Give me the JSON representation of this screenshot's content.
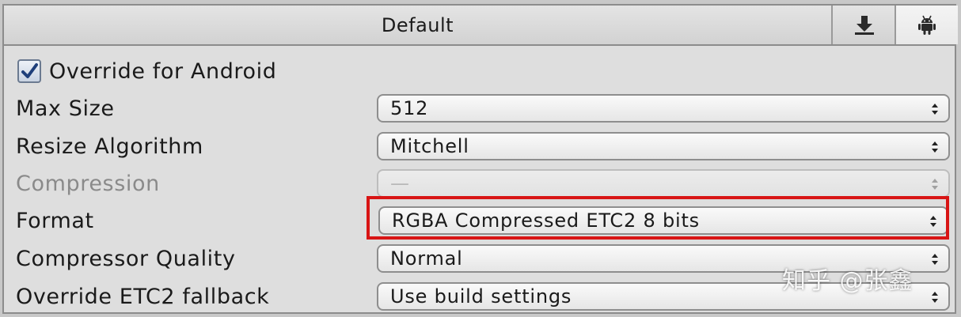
{
  "tabs": {
    "default_label": "Default",
    "download_icon": "download-icon",
    "android_icon": "android-icon"
  },
  "override": {
    "label": "Override for Android",
    "checked": true
  },
  "fields": {
    "max_size": {
      "label": "Max Size",
      "value": "512"
    },
    "resize_algorithm": {
      "label": "Resize Algorithm",
      "value": "Mitchell"
    },
    "compression": {
      "label": "Compression",
      "value": "—",
      "disabled": true
    },
    "format": {
      "label": "Format",
      "value": "RGBA Compressed ETC2 8 bits"
    },
    "compressor_quality": {
      "label": "Compressor Quality",
      "value": "Normal"
    },
    "override_etc2_fallback": {
      "label": "Override ETC2 fallback",
      "value": "Use build settings"
    }
  },
  "highlight_color": "#d81515",
  "watermark": "知乎 @张鑫"
}
